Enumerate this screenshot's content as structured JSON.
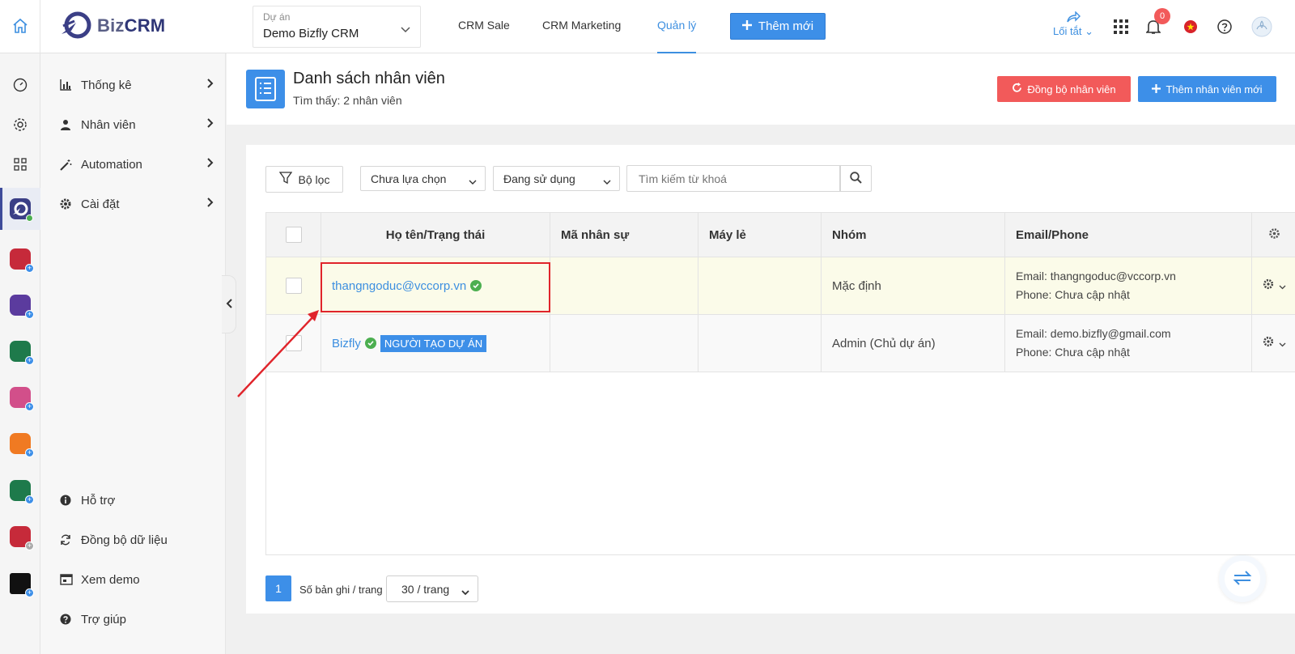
{
  "brand": {
    "name_prefix": "Biz",
    "name_suffix": "CRM"
  },
  "project": {
    "label": "Dự án",
    "value": "Demo Bizfly CRM"
  },
  "nav": {
    "items": [
      "CRM Sale",
      "CRM Marketing",
      "Quản lý"
    ],
    "active": "Quản lý",
    "add_label": "Thêm mới"
  },
  "topbar": {
    "shortcut_label": "Lối tắt",
    "notification_count": "0"
  },
  "sidebar": {
    "items": [
      {
        "label": "Thống kê",
        "icon": "bar-chart-icon"
      },
      {
        "label": "Nhân viên",
        "icon": "user-icon"
      },
      {
        "label": "Automation",
        "icon": "magic-wand-icon"
      },
      {
        "label": "Cài đặt",
        "icon": "gear-icon"
      }
    ],
    "bottom_items": [
      {
        "label": "Hỗ trợ",
        "icon": "info-icon"
      },
      {
        "label": "Đồng bộ dữ liệu",
        "icon": "sync-icon"
      },
      {
        "label": "Xem demo",
        "icon": "demo-icon"
      },
      {
        "label": "Trợ giúp",
        "icon": "help-icon"
      }
    ]
  },
  "page": {
    "title": "Danh sách nhân viên",
    "subtitle": "Tìm thấy: 2 nhân viên",
    "sync_button": "Đồng bộ nhân viên",
    "add_button": "Thêm nhân viên mới"
  },
  "filters": {
    "filter_button": "Bộ lọc",
    "select1": "Chưa lựa chọn",
    "select2": "Đang sử dụng",
    "search_placeholder": "Tìm kiếm từ khoá"
  },
  "table": {
    "columns": [
      "Họ tên/Trạng thái",
      "Mã nhân sự",
      "Máy lẻ",
      "Nhóm",
      "Email/Phone"
    ],
    "rows": [
      {
        "name": "thangngoduc@vccorp.vn",
        "tag": "",
        "code": "",
        "ext": "",
        "group": "Mặc định",
        "email": "Email: thangngoduc@vccorp.vn",
        "phone": "Phone: Chưa cập nhật"
      },
      {
        "name": "Bizfly",
        "tag": "NGƯỜI TẠO DỰ ÁN",
        "code": "",
        "ext": "",
        "group": "Admin (Chủ dự án)",
        "email": "Email: demo.bizfly@gmail.com",
        "phone": "Phone: Chưa cập nhật"
      }
    ]
  },
  "pager": {
    "current": "1",
    "per_page_label": "Số bản ghi / trang",
    "per_page_value": "30 / trang"
  },
  "colors": {
    "accent": "#3d8fe8",
    "danger": "#f25a5a",
    "highlight_row": "#fbfbe9",
    "annotation": "#e0242b"
  }
}
